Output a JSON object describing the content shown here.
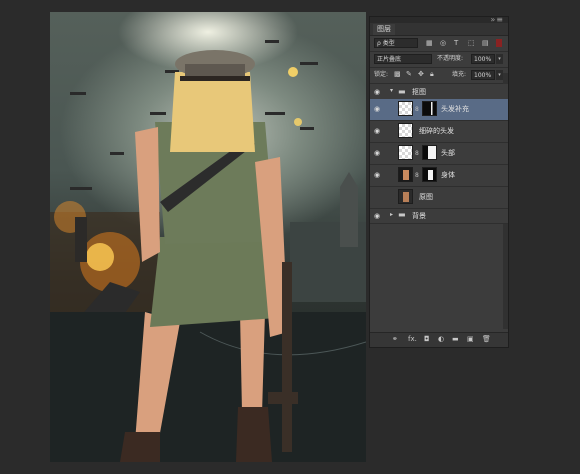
{
  "panel": {
    "tab_title": "图层",
    "top_icons": "»≡",
    "filter_label": "ρ 类型",
    "filter_icons": [
      "image-filter-icon",
      "adjustment-filter-icon",
      "text-filter-icon",
      "shape-filter-icon",
      "smart-object-filter-icon"
    ],
    "blend_mode": "正片叠底",
    "opacity_label": "不透明度:",
    "opacity_value": "100%",
    "lock_label": "锁定:",
    "fill_label": "填充:",
    "fill_value": "100%"
  },
  "layers": [
    {
      "name": "抠图",
      "type": "group",
      "expanded": true
    },
    {
      "name": "头发补充",
      "active": true
    },
    {
      "name": "细碎的头发"
    },
    {
      "name": "头部"
    },
    {
      "name": "身体"
    },
    {
      "name": "原图",
      "visible": false
    },
    {
      "name": "背景",
      "type": "group",
      "expanded": false
    }
  ],
  "bottom_icons": [
    "link-icon",
    "fx-icon",
    "add-mask-icon",
    "adjustment-icon",
    "folder-icon",
    "new-layer-icon",
    "trash-icon"
  ],
  "bottom_labels": {
    "link": "⚭",
    "fx": "fx.",
    "mask": "◘",
    "adj": "◐",
    "folder": "▬",
    "new": "▣",
    "trash": "🗑"
  }
}
